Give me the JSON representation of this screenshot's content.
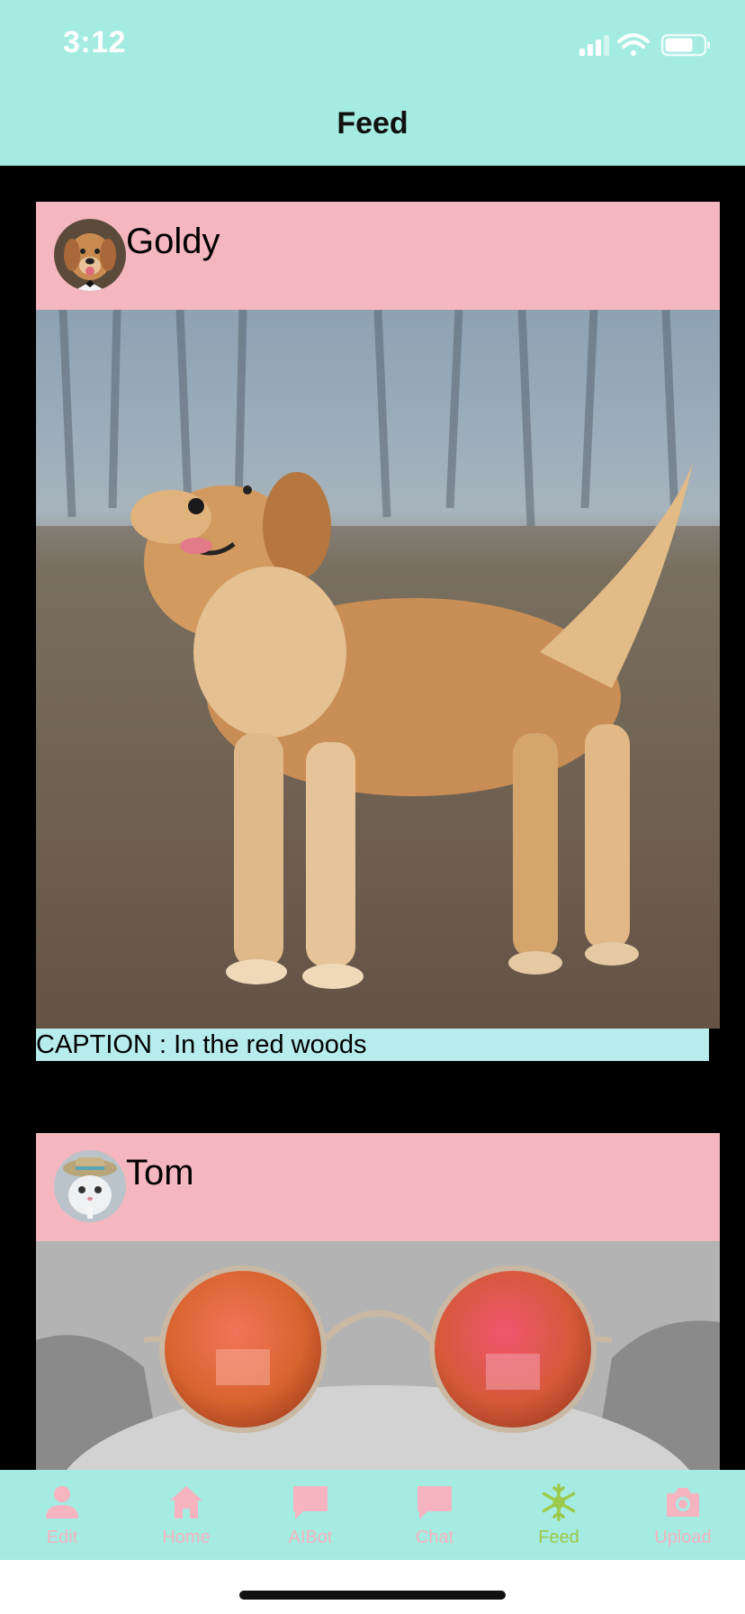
{
  "status_bar": {
    "time": "3:12",
    "signal_icon": "cellular-signal-icon",
    "wifi_icon": "wifi-icon",
    "battery_icon": "battery-icon"
  },
  "header": {
    "title": "Feed"
  },
  "posts": [
    {
      "username": "Goldy",
      "avatar_icon": "dog-avatar",
      "image_description": "golden retriever in misty woods",
      "caption": "CAPTION : In the red woods"
    },
    {
      "username": "Tom",
      "avatar_icon": "cat-avatar",
      "image_description": "grey cat wearing round orange sunglasses"
    }
  ],
  "tabs": [
    {
      "label": "Edit",
      "icon": "person-icon",
      "active": false
    },
    {
      "label": "Home",
      "icon": "home-icon",
      "active": false
    },
    {
      "label": "AIBot",
      "icon": "chat-bubble-icon",
      "active": false
    },
    {
      "label": "Chat",
      "icon": "chat-bubble-icon",
      "active": false
    },
    {
      "label": "Feed",
      "icon": "snowflake-icon",
      "active": true
    },
    {
      "label": "Upload",
      "icon": "camera-icon",
      "active": false
    }
  ],
  "colors": {
    "header_bg": "#a4ebe1",
    "post_header_bg": "#f5b7bf",
    "caption_bg": "#b7eced",
    "tab_inactive": "#f5b4c0",
    "tab_active": "#9dc94a"
  }
}
